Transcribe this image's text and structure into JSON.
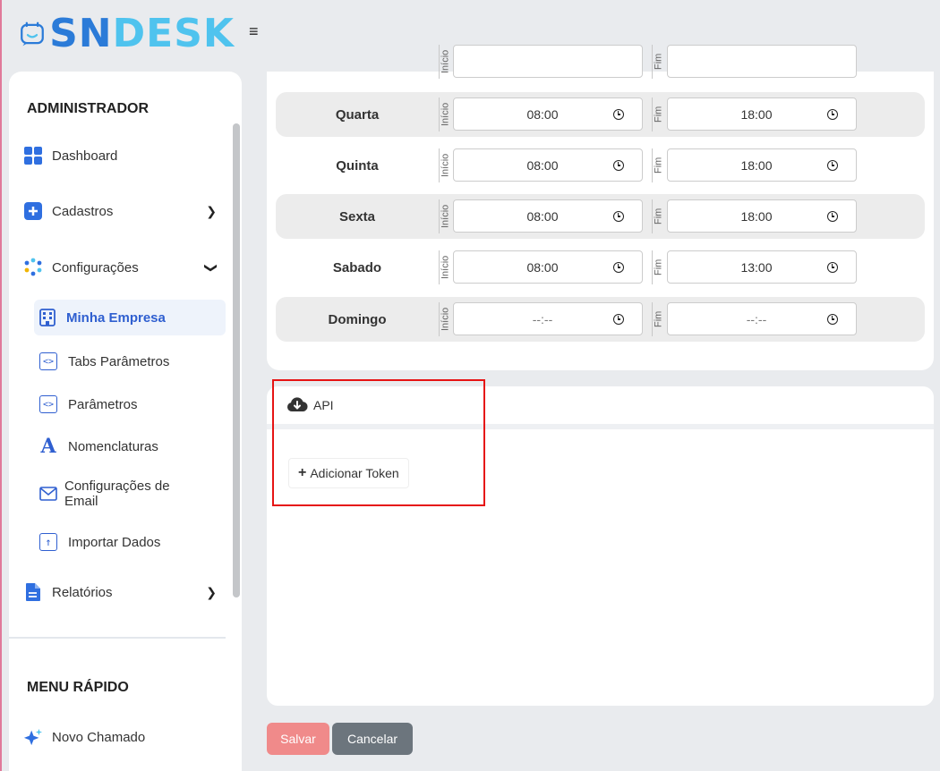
{
  "header": {
    "logo_sn": "SN",
    "logo_desk": "DESK",
    "menu_icon": "hamburger-icon"
  },
  "sidebar": {
    "section_admin": "ADMINISTRADOR",
    "items": [
      {
        "label": "Dashboard",
        "icon": "dashboard-grid-icon"
      },
      {
        "label": "Cadastros",
        "icon": "plus-square-icon"
      },
      {
        "label": "Configurações",
        "icon": "config-dots-icon"
      }
    ],
    "config_submenu": [
      {
        "label": "Minha Empresa",
        "icon": "building-icon",
        "active": true
      },
      {
        "label": "Tabs Parâmetros",
        "icon": "code-icon"
      },
      {
        "label": "Parâmetros",
        "icon": "code-icon"
      },
      {
        "label": "Nomenclaturas",
        "icon": "letter-a-icon"
      },
      {
        "label": "Configurações de Email",
        "icon": "envelope-icon"
      },
      {
        "label": "Importar Dados",
        "icon": "upload-icon"
      }
    ],
    "relatorios": {
      "label": "Relatórios",
      "icon": "report-file-icon"
    },
    "section_quick": "MENU RÁPIDO",
    "quick_items": [
      {
        "label": "Novo Chamado",
        "icon": "sparkle-icon"
      }
    ]
  },
  "schedule": {
    "start_label": "Início",
    "end_label": "Fim",
    "rows": [
      {
        "day": "Quarta",
        "start": "08:00",
        "end": "18:00"
      },
      {
        "day": "Quinta",
        "start": "08:00",
        "end": "18:00"
      },
      {
        "day": "Sexta",
        "start": "08:00",
        "end": "18:00"
      },
      {
        "day": "Sabado",
        "start": "08:00",
        "end": "13:00"
      },
      {
        "day": "Domingo",
        "start": "--:--",
        "end": "--:--"
      }
    ]
  },
  "api": {
    "title": "API",
    "add_token_label": "Adicionar Token"
  },
  "actions": {
    "save_label": "Salvar",
    "cancel_label": "Cancelar"
  },
  "colors": {
    "brand_blue": "#2b7bd8",
    "brand_light": "#4fc3ee",
    "active_menu": "#2f5fd0",
    "save_button": "#f08a8a",
    "cancel_button": "#6c757d",
    "highlight": "#e61414"
  }
}
